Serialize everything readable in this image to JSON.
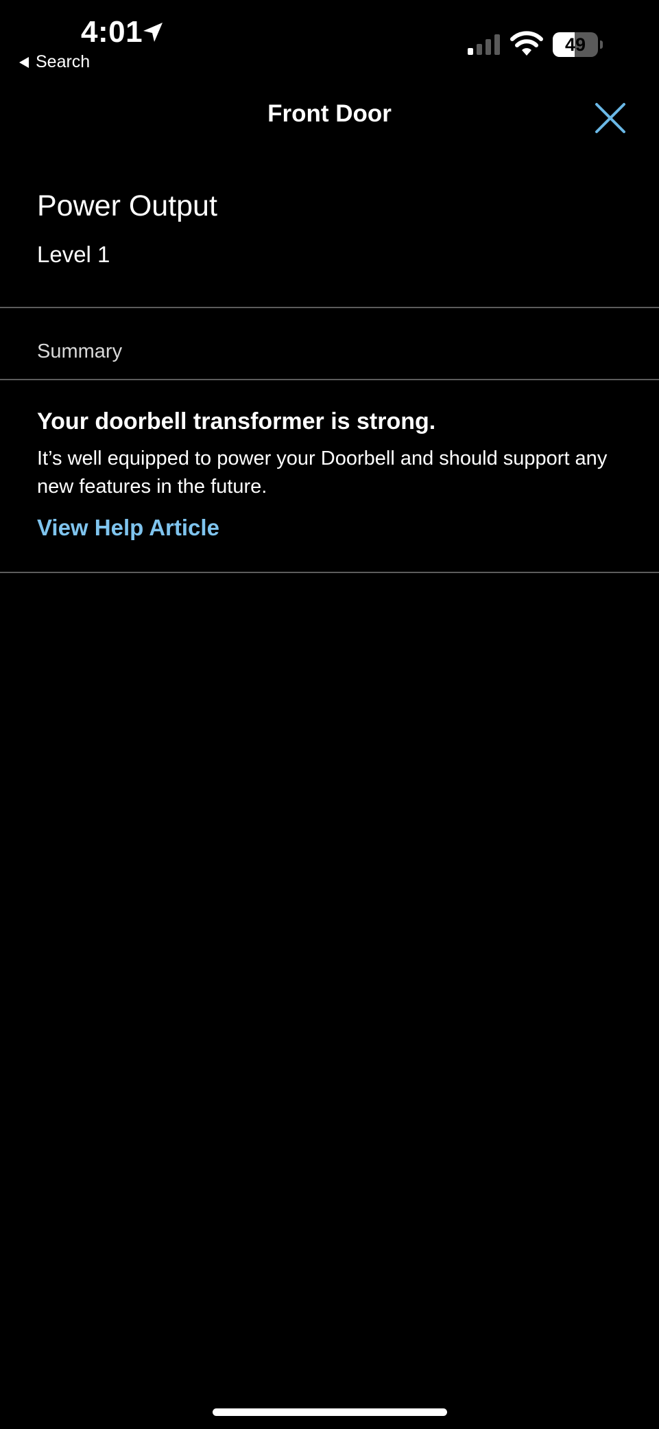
{
  "status_bar": {
    "time": "4:01",
    "back_label": "Search",
    "battery_level": "49",
    "battery_fraction": 0.49
  },
  "header": {
    "title": "Front Door",
    "close_icon": "close-icon"
  },
  "power_output": {
    "title": "Power Output",
    "value": "Level 1"
  },
  "summary": {
    "label": "Summary",
    "heading": "Your doorbell transformer is strong.",
    "body": "It’s well equipped to power your Doorbell and should support any new features in the future.",
    "link_label": "View Help Article"
  },
  "colors": {
    "background": "#000000",
    "text": "#ffffff",
    "accent_link": "#7fc4ee",
    "close_icon": "#6ab8e6",
    "divider": "#5c5c5c"
  }
}
